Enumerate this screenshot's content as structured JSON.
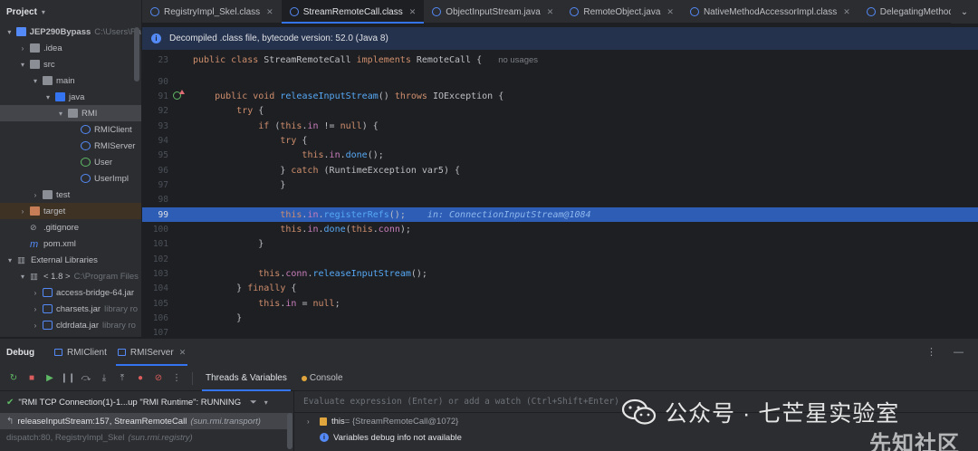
{
  "project": {
    "title": "Project",
    "rows": [
      {
        "label": "JEP290Bypass",
        "extra": "C:\\Users\\Ra",
        "type": "module",
        "indent": 0,
        "arrow": "▾",
        "bold": true
      },
      {
        "label": ".idea",
        "type": "folder",
        "indent": 1,
        "arrow": "›"
      },
      {
        "label": "src",
        "type": "folder",
        "indent": 1,
        "arrow": "▾"
      },
      {
        "label": "main",
        "type": "folder",
        "indent": 2,
        "arrow": "▾"
      },
      {
        "label": "java",
        "type": "folder-src",
        "indent": 3,
        "arrow": "▾"
      },
      {
        "label": "RMI",
        "type": "folder",
        "indent": 4,
        "arrow": "▾"
      },
      {
        "label": "RMIClient",
        "type": "class",
        "indent": 5,
        "arrow": ""
      },
      {
        "label": "RMIServer",
        "type": "class",
        "indent": 5,
        "arrow": ""
      },
      {
        "label": "User",
        "type": "interface",
        "indent": 5,
        "arrow": ""
      },
      {
        "label": "UserImpl",
        "type": "class",
        "indent": 5,
        "arrow": ""
      },
      {
        "label": "test",
        "type": "folder",
        "indent": 2,
        "arrow": "›"
      },
      {
        "label": "target",
        "type": "folder-orange",
        "indent": 1,
        "arrow": "›"
      },
      {
        "label": ".gitignore",
        "type": "file",
        "indent": 1,
        "arrow": ""
      },
      {
        "label": "pom.xml",
        "type": "maven",
        "indent": 1,
        "arrow": ""
      },
      {
        "label": "External Libraries",
        "type": "lib",
        "indent": 0,
        "arrow": "▾"
      },
      {
        "label": "< 1.8 >",
        "extra": "C:\\Program Files",
        "type": "jdk",
        "indent": 1,
        "arrow": "▾"
      },
      {
        "label": "access-bridge-64.jar",
        "type": "jar",
        "indent": 2,
        "arrow": "›"
      },
      {
        "label": "charsets.jar",
        "extra": "library ro",
        "type": "jar",
        "indent": 2,
        "arrow": "›"
      },
      {
        "label": "cldrdata.jar",
        "extra": "library ro",
        "type": "jar",
        "indent": 2,
        "arrow": "›"
      }
    ]
  },
  "tabs": [
    {
      "label": "RegistryImpl_Skel.class",
      "active": false
    },
    {
      "label": "StreamRemoteCall.class",
      "active": true
    },
    {
      "label": "ObjectInputStream.java",
      "active": false
    },
    {
      "label": "RemoteObject.java",
      "active": false
    },
    {
      "label": "NativeMethodAccessorImpl.class",
      "active": false
    },
    {
      "label": "DelegatingMethod",
      "active": false
    }
  ],
  "banner": {
    "text": "Decompiled .class file, bytecode version: 52.0 (Java 8)"
  },
  "editor": {
    "sticky": {
      "line": "23",
      "hint": "no usages"
    },
    "highlight_line": "99",
    "lines": [
      {
        "n": "90",
        "code": ""
      },
      {
        "n": "91",
        "code": "    public void releaseInputStream() throws IOException {",
        "mark": true
      },
      {
        "n": "92",
        "code": "        try {"
      },
      {
        "n": "93",
        "code": "            if (this.in != null) {"
      },
      {
        "n": "94",
        "code": "                try {"
      },
      {
        "n": "95",
        "code": "                    this.in.done();"
      },
      {
        "n": "96",
        "code": "                } catch (RuntimeException var5) {"
      },
      {
        "n": "97",
        "code": "                }"
      },
      {
        "n": "98",
        "code": ""
      },
      {
        "n": "99",
        "code": "                this.in.registerRefs();",
        "inline": "in: ConnectionInputStream@1084"
      },
      {
        "n": "100",
        "code": "                this.in.done(this.conn);"
      },
      {
        "n": "101",
        "code": "            }"
      },
      {
        "n": "102",
        "code": ""
      },
      {
        "n": "103",
        "code": "            this.conn.releaseInputStream();"
      },
      {
        "n": "104",
        "code": "        } finally {"
      },
      {
        "n": "105",
        "code": "            this.in = null;"
      },
      {
        "n": "106",
        "code": "        }"
      },
      {
        "n": "107",
        "code": ""
      }
    ]
  },
  "debug": {
    "title": "Debug",
    "tabs": [
      {
        "label": "RMIClient",
        "active": false
      },
      {
        "label": "RMIServer",
        "active": true
      }
    ],
    "view_tabs": [
      {
        "label": "Threads & Variables",
        "active": true
      },
      {
        "label": "Console",
        "active": false
      }
    ],
    "thread": "\"RMI TCP Connection(1)-1...up \"RMI Runtime\": RUNNING",
    "frames": [
      {
        "method": "releaseInputStream:157, StreamRemoteCall",
        "pkg": "(sun.rmi.transport)",
        "selected": true
      },
      {
        "method": "dispatch:80, RegistryImpl_Skel",
        "pkg": "(sun.rmi.registry)",
        "selected": false
      }
    ],
    "eval_placeholder": "Evaluate expression (Enter) or add a watch (Ctrl+Shift+Enter)",
    "variables": [
      {
        "name": "this",
        "value": " = {StreamRemoteCall@1072}"
      }
    ],
    "info": "Variables debug info not available"
  },
  "watermark": {
    "text": "公众号 · 七芒星实验室",
    "text2": "先知社区"
  },
  "colors": {
    "accent": "#3574f0",
    "highlight_line": "#2e5db5",
    "keyword": "#cf8e6d",
    "function": "#56a8f5",
    "field": "#c77dbb"
  }
}
